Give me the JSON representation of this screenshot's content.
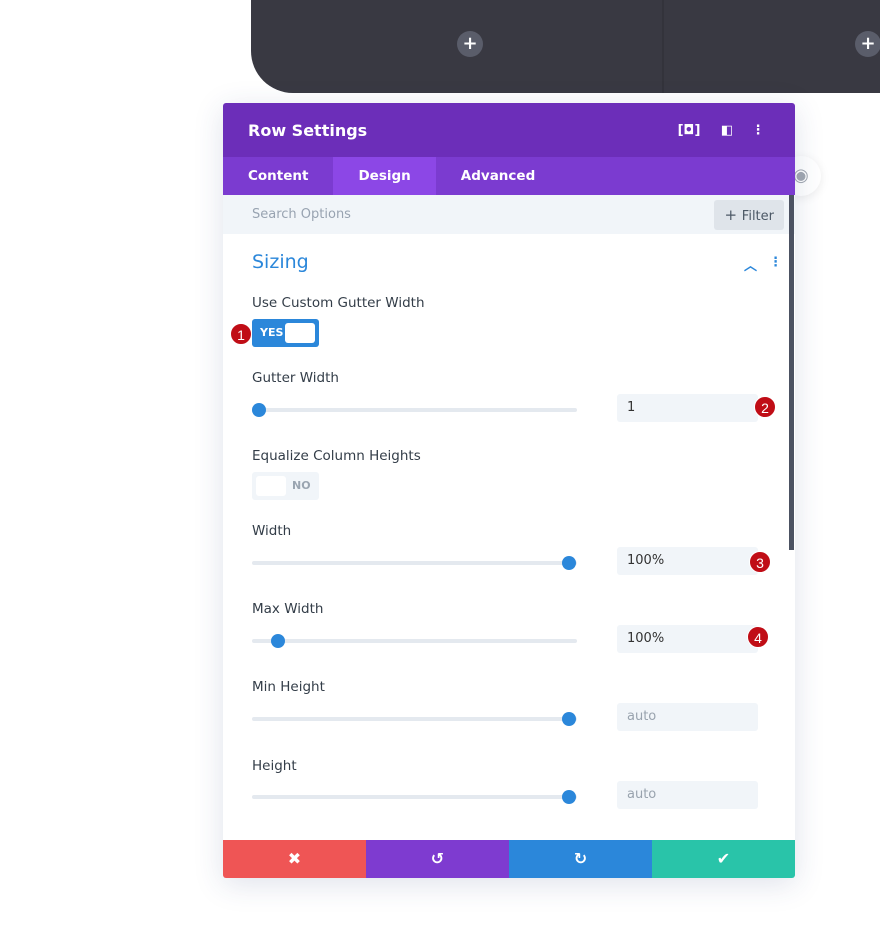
{
  "canvas": {
    "column_add_icon": "plus-icon"
  },
  "panel": {
    "title": "Row Settings",
    "header_icons": [
      "focus-icon",
      "split-view-icon",
      "more-vertical-icon"
    ],
    "tabs": [
      {
        "label": "Content",
        "active": false
      },
      {
        "label": "Design",
        "active": true
      },
      {
        "label": "Advanced",
        "active": false
      }
    ],
    "search_placeholder": "Search Options",
    "filter_label": "Filter",
    "section_title": "Sizing",
    "fields": {
      "custom_gutter": {
        "label": "Use Custom Gutter Width",
        "value": "YES"
      },
      "gutter_width": {
        "label": "Gutter Width",
        "value": "1",
        "slider": 0
      },
      "equalize": {
        "label": "Equalize Column Heights",
        "value": "NO"
      },
      "width": {
        "label": "Width",
        "value": "100%",
        "slider": 1
      },
      "max_width": {
        "label": "Max Width",
        "value": "100%",
        "slider": 0.06
      },
      "min_height": {
        "label": "Min Height",
        "placeholder": "auto",
        "slider": 1
      },
      "height": {
        "label": "Height",
        "placeholder": "auto",
        "slider": 1
      }
    },
    "badges": [
      "1",
      "2",
      "3",
      "4"
    ],
    "footer": [
      {
        "icon": "close-icon",
        "color": "#ef5555"
      },
      {
        "icon": "undo-icon",
        "color": "#7e3bd0"
      },
      {
        "icon": "redo-icon",
        "color": "#2b87da"
      },
      {
        "icon": "check-icon",
        "color": "#29c4a9"
      }
    ]
  },
  "colors": {
    "header": "#6c2eb9",
    "tabs": "#7b3bd0",
    "accent": "#2b87da",
    "badge": "#c00d16"
  }
}
